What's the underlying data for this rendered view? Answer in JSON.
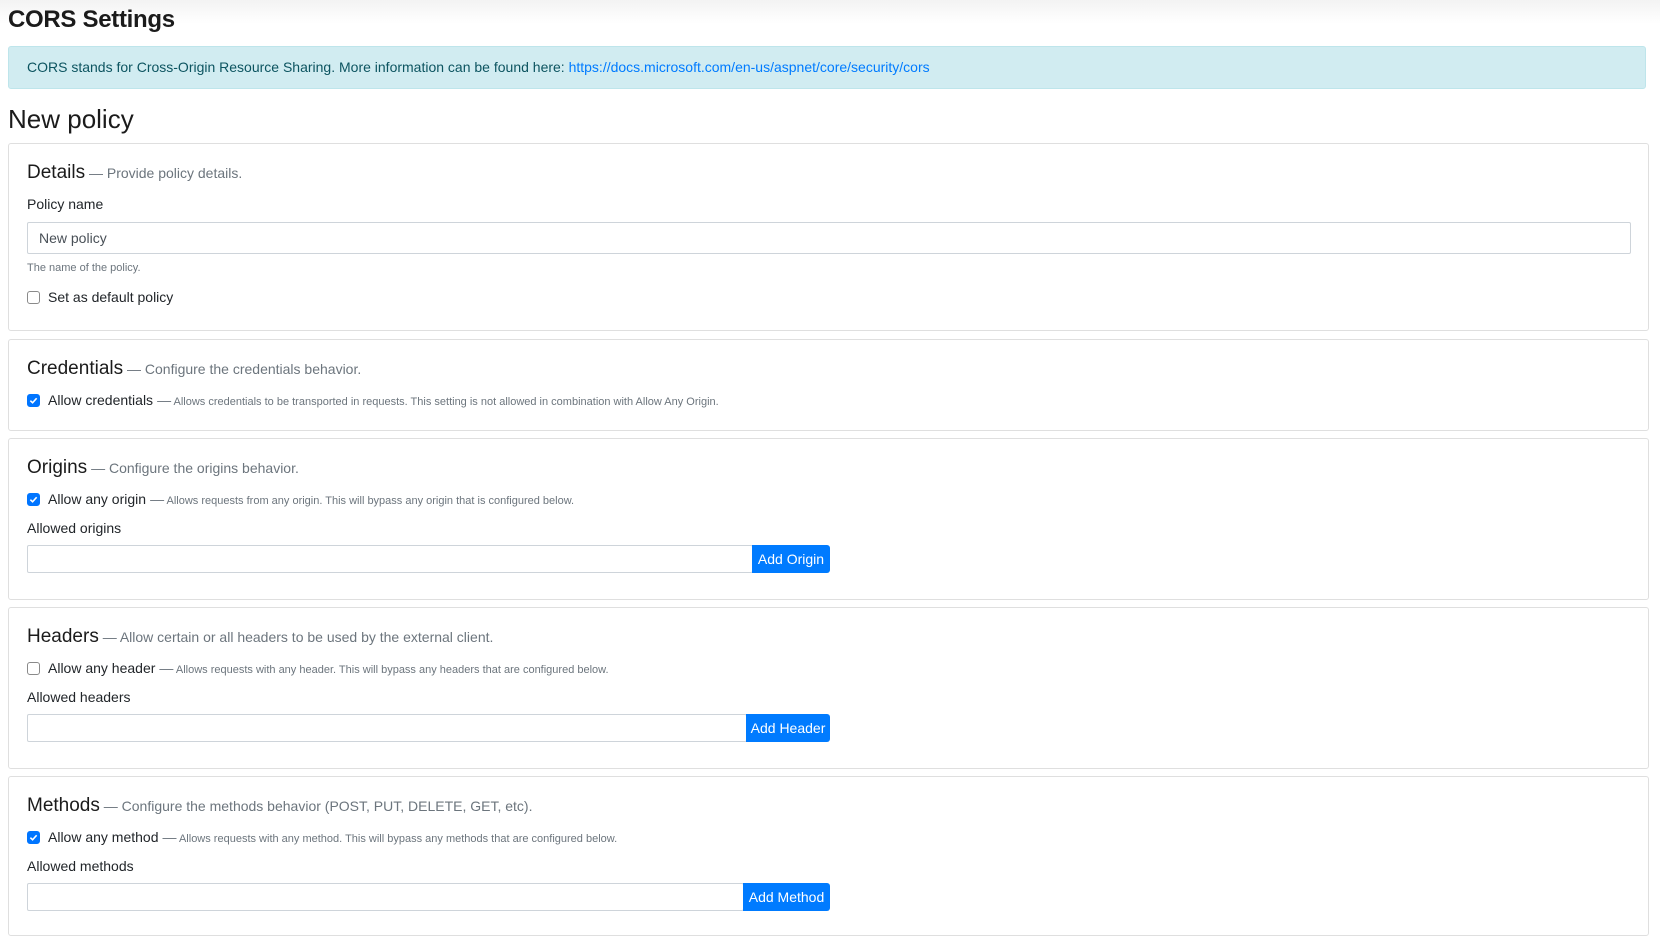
{
  "page": {
    "title": "CORS Settings",
    "info_text": "CORS stands for Cross-Origin Resource Sharing. More information can be found here: ",
    "info_link": "https://docs.microsoft.com/en-us/aspnet/core/security/cors",
    "subtitle": "New policy"
  },
  "details": {
    "title": "Details",
    "desc": "— Provide policy details.",
    "name_label": "Policy name",
    "name_value": "New policy",
    "name_hint": "The name of the policy.",
    "default_label": "Set as default policy",
    "default_checked": false
  },
  "credentials": {
    "title": "Credentials",
    "desc": "— Configure the credentials behavior.",
    "allow_label": "Allow credentials",
    "allow_dash": "—",
    "allow_desc": "Allows credentials to be transported in requests. This setting is not allowed in combination with Allow Any Origin.",
    "allow_checked": true
  },
  "origins": {
    "title": "Origins",
    "desc": "— Configure the origins behavior.",
    "allow_label": "Allow any origin",
    "allow_dash": "—",
    "allow_desc": "Allows requests from any origin. This will bypass any origin that is configured below.",
    "allow_checked": true,
    "list_label": "Allowed origins",
    "input_value": "",
    "button_label": "Add Origin"
  },
  "headers": {
    "title": "Headers",
    "desc": "— Allow certain or all headers to be used by the external client.",
    "allow_label": "Allow any header",
    "allow_dash": "—",
    "allow_desc": "Allows requests with any header. This will bypass any headers that are configured below.",
    "allow_checked": false,
    "list_label": "Allowed headers",
    "input_value": "",
    "button_label": "Add Header"
  },
  "methods": {
    "title": "Methods",
    "desc": "— Configure the methods behavior (POST, PUT, DELETE, GET, etc).",
    "allow_label": "Allow any method",
    "allow_dash": "—",
    "allow_desc": "Allows requests with any method. This will bypass any methods that are configured below.",
    "allow_checked": true,
    "list_label": "Allowed methods",
    "input_value": "",
    "button_label": "Add Method"
  },
  "colors": {
    "primary": "#007bff",
    "info_background": "#d1ecf1",
    "checkbox_checked": "#0075ff"
  }
}
